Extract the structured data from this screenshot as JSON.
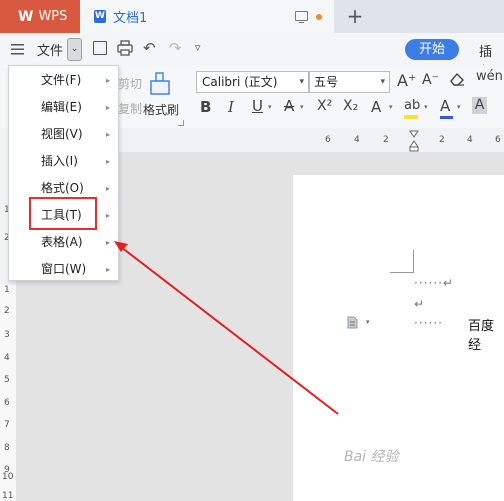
{
  "titlebar": {
    "wps_label": "WPS",
    "doc_tab": "文档1",
    "new_tab_symbol": "+"
  },
  "toolbar": {
    "menu_label": "文件",
    "menu_drop_symbol": "⌄",
    "start_tab": "开始",
    "insert_tab": "插入"
  },
  "ribbon": {
    "cut": "剪切",
    "copy": "复制",
    "format_painter": "格式刷",
    "font_name": "Calibri (正文)",
    "font_size": "五号",
    "grow": "A⁺",
    "shrink": "A⁻",
    "pinyin": "wén",
    "bold": "B",
    "italic": "I",
    "underline": "U",
    "strike": "A",
    "superscript": "X²",
    "subscript": "X₂",
    "char_style": "A",
    "highlight": "ab",
    "font_color": "A",
    "char_shade": "A"
  },
  "ruler": {
    "numbers": [
      "6",
      "4",
      "2",
      "2",
      "4",
      "6"
    ]
  },
  "vruler": {
    "numbers": [
      "1",
      "2",
      "1",
      "2",
      "3",
      "4",
      "5",
      "6",
      "7",
      "8",
      "9",
      "10",
      "11"
    ]
  },
  "dropdown": {
    "items": [
      {
        "label": "文件(F)"
      },
      {
        "label": "编辑(E)"
      },
      {
        "label": "视图(V)"
      },
      {
        "label": "插入(I)"
      },
      {
        "label": "格式(O)"
      },
      {
        "label": "工具(T)"
      },
      {
        "label": "表格(A)"
      },
      {
        "label": "窗口(W)"
      }
    ]
  },
  "document": {
    "line1": "······↵",
    "line2": "↵",
    "line3_dots": "······",
    "line3_text": "百度经"
  },
  "watermark": "Bai 经验",
  "colors": {
    "accent": "#3b7de5",
    "wps_red": "#d8593f",
    "highlight_red": "#e03030"
  }
}
